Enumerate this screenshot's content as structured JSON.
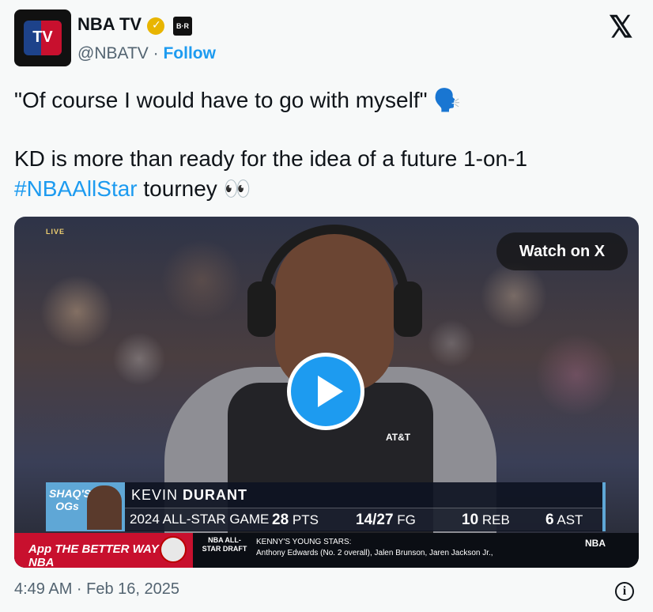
{
  "account": {
    "name": "NBA TV",
    "handle": "@NBATV",
    "separator": "·",
    "follow_label": "Follow",
    "avatar_text": "TV",
    "affiliate_badge": "B·R",
    "verified_icon": "verified-gold-check-icon"
  },
  "tweet": {
    "line1": "\"Of course I would have to go with myself\"",
    "line1_emoji": "🗣️",
    "line2": "KD is more than ready for the idea of a future 1-on-1",
    "hashtag": "#NBAAllStar",
    "line3_rest": " tourney",
    "line3_emoji": "👀"
  },
  "media": {
    "live_label": "LIVE",
    "watch_button": "Watch on X",
    "sponsor": "AT&T",
    "lower_third": {
      "og_label": "SHAQ'S OGs",
      "first_name": "KEVIN",
      "last_name": "DURANT",
      "event": "2024 ALL-STAR GAME",
      "stats": [
        {
          "value": "28",
          "label": "PTS"
        },
        {
          "value": "14/27",
          "label": "FG"
        },
        {
          "value": "10",
          "label": "REB"
        },
        {
          "value": "6",
          "label": "AST"
        }
      ]
    },
    "ticker": {
      "app_label": "App",
      "slogan": "THE BETTER WAY TO NBA",
      "draft_label": "NBA ALL-STAR DRAFT",
      "kenny_title": "KENNY'S YOUNG STARS:",
      "kenny_body": "Anthony Edwards (No. 2 overall), Jalen Brunson, Jaren Jackson Jr.,",
      "nba_logo": "NBA"
    }
  },
  "footer": {
    "timestamp": "4:49 AM · Feb 16, 2025",
    "info_icon": "info-icon"
  },
  "colors": {
    "accent": "#1d9bf0",
    "text": "#0f1419",
    "secondary": "#536471",
    "nba_red": "#c8102e",
    "nba_blue": "#1d428a"
  }
}
